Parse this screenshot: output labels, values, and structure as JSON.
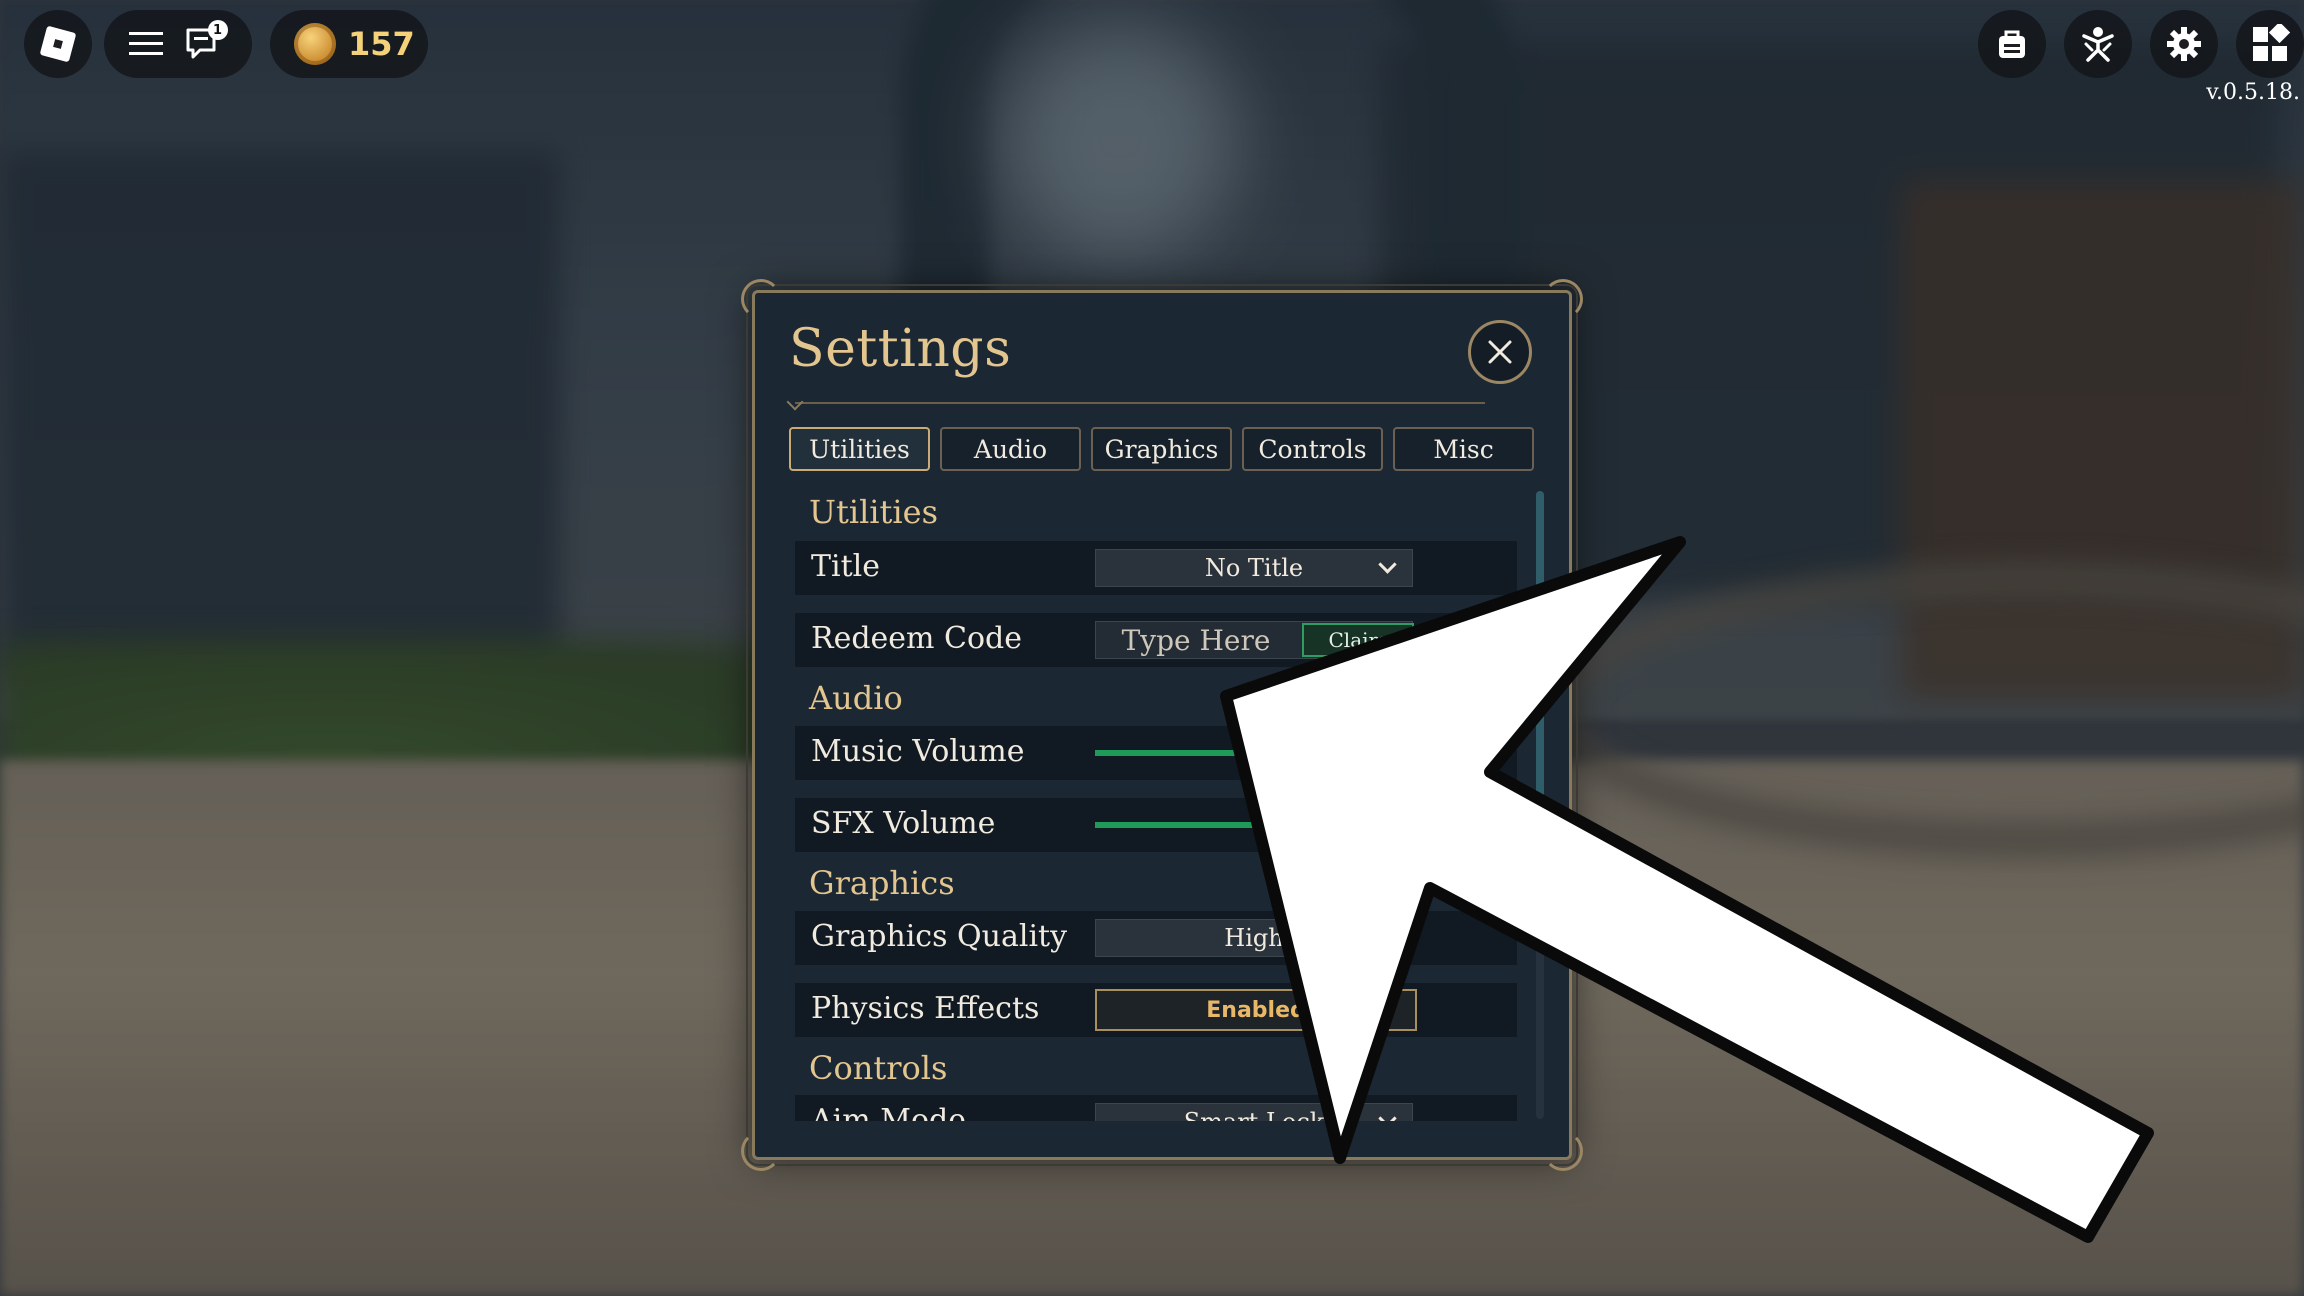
{
  "topbar": {
    "notification_count": "1",
    "coins": "157",
    "version": "v.0.5.18."
  },
  "icons": {
    "roblox": "roblox-logo-icon",
    "menu": "hamburger-menu-icon",
    "chat": "chat-icon",
    "coin": "coin-icon",
    "backpack": "backpack-icon",
    "emotes": "emote-figure-icon",
    "settings": "gear-icon",
    "apps": "grid-apps-icon",
    "close": "close-icon",
    "arrow": "pointer-arrow-icon"
  },
  "settings": {
    "title": "Settings",
    "tabs": [
      {
        "label": "Utilities",
        "active": true
      },
      {
        "label": "Audio",
        "active": false
      },
      {
        "label": "Graphics",
        "active": false
      },
      {
        "label": "Controls",
        "active": false
      },
      {
        "label": "Misc",
        "active": false
      }
    ],
    "sections": {
      "utilities": "Utilities",
      "audio": "Audio",
      "graphics": "Graphics",
      "controls": "Controls"
    },
    "rows": {
      "title": {
        "label": "Title",
        "value": "No Title"
      },
      "redeem": {
        "label": "Redeem Code",
        "placeholder": "Type Here",
        "button": "Claim"
      },
      "music": {
        "label": "Music Volume",
        "value": 0.52
      },
      "sfx": {
        "label": "SFX Volume",
        "value": 0.6
      },
      "quality": {
        "label": "Graphics Quality",
        "value": "High"
      },
      "physics": {
        "label": "Physics Effects",
        "value": "Enabled"
      },
      "aim": {
        "label": "Aim Mode",
        "value": "Smart Lock"
      }
    }
  },
  "colors": {
    "accent_gold": "#e3c58f",
    "slider_green": "#1f9a58",
    "panel_bg": "#1b2733"
  }
}
